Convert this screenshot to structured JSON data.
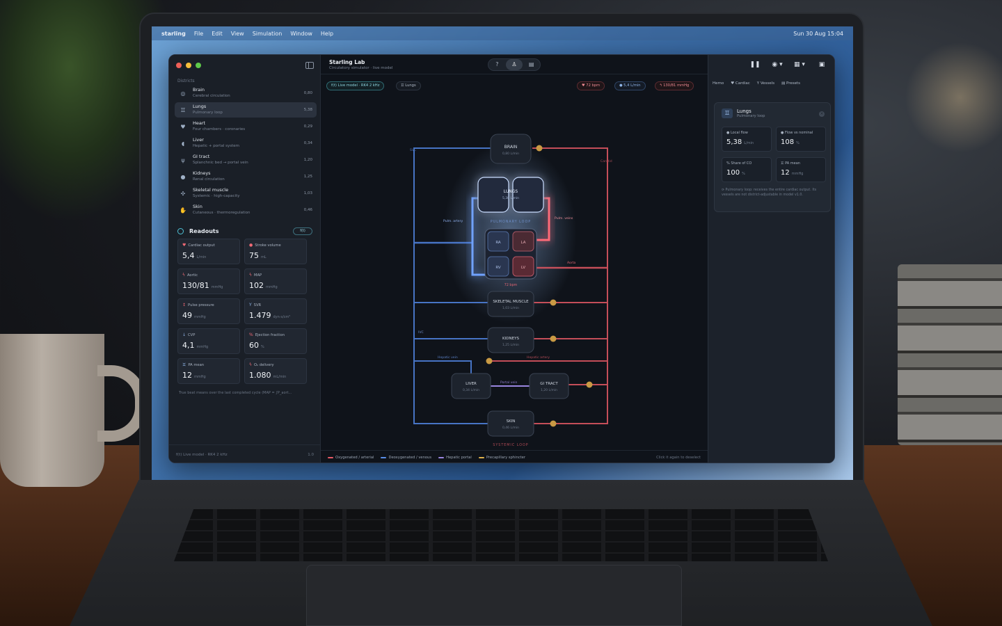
{
  "menubar": {
    "app": "starling",
    "items": [
      "File",
      "Edit",
      "View",
      "Simulation",
      "Window",
      "Help"
    ],
    "clock": "Sun 30 Aug  15:04"
  },
  "sidebar": {
    "section_title": "Districts",
    "districts": [
      {
        "name": "Brain",
        "sub": "Cerebral circulation",
        "value": "0,80",
        "icon": "brain-icon",
        "glyph": "◎"
      },
      {
        "name": "Lungs",
        "sub": "Pulmonary loop",
        "value": "5,38",
        "icon": "lungs-icon",
        "glyph": "♊"
      },
      {
        "name": "Heart",
        "sub": "Four chambers · coronaries",
        "value": "0,29",
        "icon": "heart-icon",
        "glyph": "♥"
      },
      {
        "name": "Liver",
        "sub": "Hepatic + portal system",
        "value": "0,34",
        "icon": "liver-icon",
        "glyph": "◖"
      },
      {
        "name": "GI tract",
        "sub": "Splanchnic bed → portal vein",
        "value": "1,20",
        "icon": "cutlery-icon",
        "glyph": "ψ"
      },
      {
        "name": "Kidneys",
        "sub": "Renal circulation",
        "value": "1,25",
        "icon": "drop-icon",
        "glyph": "●"
      },
      {
        "name": "Skeletal muscle",
        "sub": "Systemic · high-capacity",
        "value": "1,03",
        "icon": "figure-icon",
        "glyph": "✣"
      },
      {
        "name": "Skin",
        "sub": "Cutaneous · thermoregulation",
        "value": "0,46",
        "icon": "hand-icon",
        "glyph": "✋"
      }
    ],
    "readouts_title": "Readouts",
    "readouts_pill": "f(t)",
    "readouts": [
      {
        "label": "Cardiac output",
        "value": "5,4",
        "unit": "L/min",
        "glyph": "♥",
        "color": "#f06a75"
      },
      {
        "label": "Stroke volume",
        "value": "75",
        "unit": "mL",
        "glyph": "●",
        "color": "#f06a75"
      },
      {
        "label": "Aortic",
        "value": "130/81",
        "unit": "mmHg",
        "glyph": "ϟ",
        "color": "#f06a75"
      },
      {
        "label": "MAP",
        "value": "102",
        "unit": "mmHg",
        "glyph": "ϟ",
        "color": "#f06a75"
      },
      {
        "label": "Pulse pressure",
        "value": "49",
        "unit": "mmHg",
        "glyph": "↕",
        "color": "#f06a75"
      },
      {
        "label": "SVR",
        "value": "1.479",
        "unit": "dyn·s/cm⁵",
        "glyph": "Y",
        "color": "#8fb5e8"
      },
      {
        "label": "CVP",
        "value": "4,1",
        "unit": "mmHg",
        "glyph": "↓",
        "color": "#8fb5e8"
      },
      {
        "label": "Ejection fraction",
        "value": "60",
        "unit": "%",
        "glyph": "%",
        "color": "#f06a75"
      },
      {
        "label": "PA mean",
        "value": "12",
        "unit": "mmHg",
        "glyph": "♊",
        "color": "#8fb5e8"
      },
      {
        "label": "O₂ delivery",
        "value": "1.080",
        "unit": "mL/min",
        "glyph": "ϟ",
        "color": "#f06a75"
      }
    ],
    "footnote": "True beat means over the last completed cycle (MAP = ∫P_aort...",
    "footer_model": "f(t)   Live model · RK4 2 kHz",
    "footer_version": "1.0"
  },
  "center": {
    "title": "Starling Lab",
    "subtitle": "Circulatory simulator · live model",
    "seg_icons": [
      "?",
      "♙",
      "▤"
    ],
    "chips": {
      "model": "f(t)   Live model · RK4 2 kHz",
      "selection": "♊   Lungs",
      "hr": "♥   72 bpm",
      "co": "●   5,4 L/min",
      "bp": "ϟ   130/81 mmHg"
    },
    "diagram": {
      "brain": "BRAIN",
      "brain_val": "0,80 L/min",
      "lungs": "LUNGS",
      "lungs_val": "5,38 L/min",
      "pulm_loop": "PULMONARY LOOP",
      "ra": "RA",
      "la": "LA",
      "rv": "RV",
      "lv": "LV",
      "hr": "72 bpm",
      "muscle": "SKELETAL MUSCLE",
      "muscle_val": "1,03 L/min",
      "kidneys": "KIDNEYS",
      "kidneys_val": "1,25 L/min",
      "liver": "LIVER",
      "liver_val": "0,34 L/min",
      "gi": "GI TRACT",
      "gi_val": "1,20 L/min",
      "skin": "SKIN",
      "skin_val": "0,46 L/min",
      "systemic_loop": "SYSTEMIC LOOP",
      "svc": "SVC",
      "carotid": "Carotid",
      "pulm_artery": "Pulm. artery",
      "pulm_veins": "Pulm. veins",
      "aorta": "Aorta",
      "ivc": "IVC",
      "hepatic_vein": "Hepatic vein",
      "hepatic_artery": "Hepatic artery",
      "portal_vein": "Portal vein"
    },
    "legend": [
      {
        "label": "Oxygenated / arterial",
        "color": "#e85a66"
      },
      {
        "label": "Deoxygenated / venous",
        "color": "#5a8ee8"
      },
      {
        "label": "Hepatic portal",
        "color": "#9a86e0"
      },
      {
        "label": "Precapillary sphincter",
        "color": "#e0b14a"
      }
    ],
    "legend_hint": "Click it again to deselect"
  },
  "right": {
    "tools": [
      "❚❚",
      "◉ ▾",
      "▦ ▾",
      "▣"
    ],
    "tabs": [
      "Hemo",
      "♥  Cardiac",
      "Y  Vessels",
      "▤  Presets"
    ],
    "panel": {
      "name": "Lungs",
      "sub": "Pulmonary loop",
      "cards": [
        {
          "label": "● Local flow",
          "value": "5,38",
          "unit": "L/min"
        },
        {
          "label": "● Flow vs nominal",
          "value": "108",
          "unit": "%"
        },
        {
          "label": "% Share of CO",
          "value": "100",
          "unit": "%"
        },
        {
          "label": "♊ PA mean",
          "value": "12",
          "unit": "mmHg"
        }
      ],
      "note": "⟳  Pulmonary loop: receives the entire cardiac output. Its vessels are not district-adjustable in model v1.0."
    }
  }
}
